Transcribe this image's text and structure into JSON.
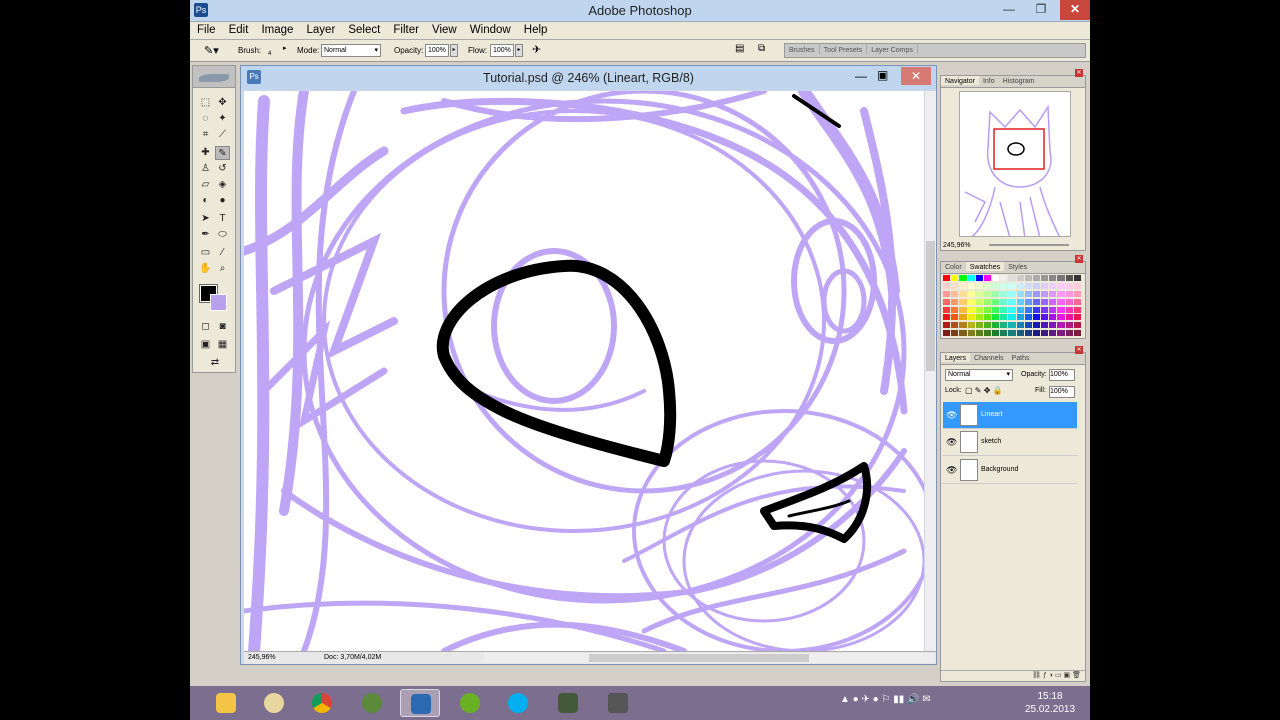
{
  "window": {
    "title": "Adobe Photoshop",
    "app_icon": "photoshop-icon",
    "min": "—",
    "max": "❐",
    "close": "✕"
  },
  "menu": [
    "File",
    "Edit",
    "Image",
    "Layer",
    "Select",
    "Filter",
    "View",
    "Window",
    "Help"
  ],
  "options": {
    "brush_label": "Brush:",
    "brush_size": "4",
    "mode_label": "Mode:",
    "mode_value": "Normal",
    "opacity_label": "Opacity:",
    "opacity_value": "100%",
    "flow_label": "Flow:",
    "flow_value": "100%"
  },
  "palette_well": [
    "Brushes",
    "Tool Presets",
    "Layer Comps"
  ],
  "document": {
    "title": "Tutorial.psd @ 246% (Lineart, RGB/8)",
    "zoom": "245,96%",
    "doc_info": "Doc: 3,70M/4,02M"
  },
  "navigator": {
    "tabs": [
      "Navigator",
      "Info",
      "Histogram"
    ],
    "zoom": "245,96%"
  },
  "swatches": {
    "tabs": [
      "Color",
      "Swatches",
      "Styles"
    ]
  },
  "layers": {
    "tabs": [
      "Layers",
      "Channels",
      "Paths"
    ],
    "blend_mode": "Normal",
    "opacity_label": "Opacity:",
    "opacity_value": "100%",
    "lock_label": "Lock:",
    "fill_label": "Fill:",
    "fill_value": "100%",
    "items": [
      {
        "name": "Lineart",
        "selected": true
      },
      {
        "name": "sketch",
        "selected": false
      },
      {
        "name": "Background",
        "selected": false
      }
    ]
  },
  "colors": {
    "foreground": "#000000",
    "background": "#b8a0ec",
    "sketch": "#b79cf4",
    "selection": "#3399ff"
  },
  "taskbar": {
    "apps": [
      "file-explorer",
      "paint",
      "chrome",
      "game",
      "photoshop",
      "spotify",
      "skype",
      "media-player",
      "game-2"
    ],
    "time": "15:18",
    "date": "25.02.2013"
  }
}
